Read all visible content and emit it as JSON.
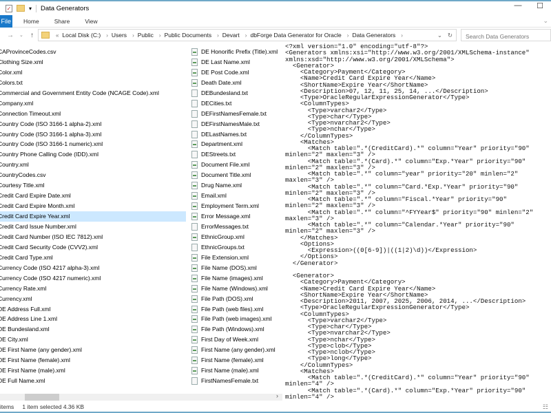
{
  "window": {
    "title": "Data Generators",
    "minimize": "—",
    "maximize": "☐"
  },
  "ribbon": {
    "file": "File",
    "tabs": [
      "Home",
      "Share",
      "View"
    ]
  },
  "address": {
    "prefix": "«",
    "crumbs": [
      "Local Disk (C:)",
      "Users",
      "Public",
      "Public Documents",
      "Devart",
      "dbForge Data Generator for Oracle",
      "Data Generators"
    ]
  },
  "search": {
    "placeholder": "Search Data Generators"
  },
  "files": {
    "column1": [
      "CAProvinceCodes.csv",
      "Clothing Size.xml",
      "Color.xml",
      "Colors.txt",
      "Commercial and Government Entity Code (NCAGE Code).xml",
      "Company.xml",
      "Connection Timeout.xml",
      "Country Code (ISO 3166-1 alpha-2).xml",
      "Country Code (ISO 3166-1 alpha-3).xml",
      "Country Code (ISO 3166-1 numeric).xml",
      "Country Phone Calling Code (IDD).xml",
      "Country.xml",
      "CountryCodes.csv",
      "Courtesy Title.xml",
      "Credit Card Expire Date.xml",
      "Credit Card Expire Month.xml",
      "Credit Card Expire Year.xml",
      "Credit Card Issue Number.xml",
      "Credit Card Number (ISO IEC 7812).xml",
      "Credit Card Security Code (CVV2).xml",
      "Credit Card Type.xml",
      "Currency Code (ISO 4217 alpha-3).xml",
      "Currency Code (ISO 4217 numeric).xml",
      "Currency Rate.xml",
      "Currency.xml",
      "DE Address Full.xml",
      "DE Address Line 1.xml",
      "DE Bundesland.xml",
      "DE City.xml",
      "DE First Name (any gender).xml",
      "DE First Name (female).xml",
      "DE First Name (male).xml",
      "DE Full Name.xml"
    ],
    "column2": [
      "DE Honorific Prefix (Title).xml",
      "DE Last Name.xml",
      "DE Post Code.xml",
      "Death Date.xml",
      "DEBundesland.txt",
      "DECities.txt",
      "DEFirstNamesFemale.txt",
      "DEFirstNamesMale.txt",
      "DELastNames.txt",
      "Department.xml",
      "DEStreets.txt",
      "Document File.xml",
      "Document Title.xml",
      "Drug Name.xml",
      "Email.xml",
      "Employment Term.xml",
      "Error Message.xml",
      "ErrorMessages.txt",
      "EthnicGroup.xml",
      "EthnicGroups.txt",
      "File Extension.xml",
      "File Name (DOS).xml",
      "File Name (images).xml",
      "File Name (Windows).xml",
      "File Path (DOS).xml",
      "File Path (web files).xml",
      "File Path (web images).xml",
      "File Path (Windows).xml",
      "First Day of Week.xml",
      "First Name (any gender).xml",
      "First Name (female).xml",
      "First Name (male).xml",
      "FirstNamesFemale.txt"
    ],
    "selected": "Credit Card Expire Year.xml"
  },
  "status": {
    "items": "items",
    "selected": "1 item selected  4.36 KB"
  },
  "preview": {
    "text": "<?xml version=\"1.0\" encoding=\"utf-8\"?>\n<Generators xmlns:xsi=\"http://www.w3.org/2001/XMLSchema-instance\"\nxmlns:xsd=\"http://www.w3.org/2001/XMLSchema\">\n  <Generator>\n    <Category>Payment</Category>\n    <Name>Credit Card Expire Year</Name>\n    <ShortName>Expire Year</ShortName>\n    <Description>07, 12, 11, 25, 14, ...</Description>\n    <Type>OracleRegularExpressionGenerator</Type>\n    <ColumnTypes>\n      <Type>varchar2</Type>\n      <Type>char</Type>\n      <Type>nvarchar2</Type>\n      <Type>nchar</Type>\n    </ColumnTypes>\n    <Matches>\n      <Match table=\".*(CreditCard).*\" column=\"Year\" priority=\"90\"\nminlen=\"2\" maxlen=\"3\" />\n      <Match table=\".*(Card).*\" column=\"Exp.*Year\" priority=\"90\"\nminlen=\"2\" maxlen=\"3\" />\n      <Match table=\".*\" column=\"year\" priority=\"20\" minlen=\"2\"\nmaxlen=\"3\" />\n      <Match table=\".*\" column=\"Card.*Exp.*Year\" priority=\"90\"\nminlen=\"2\" maxlen=\"3\" />\n      <Match table=\".*\" column=\"Fiscal.*Year\" priority=\"90\"\nminlen=\"2\" maxlen=\"3\" />\n      <Match table=\".*\" column=\"^FYYear$\" priority=\"90\" minlen=\"2\"\nmaxlen=\"3\" />\n      <Match table=\".*\" column=\"Calendar.*Year\" priority=\"90\"\nminlen=\"2\" maxlen=\"3\" />\n    </Matches>\n    <Options>\n      <Expression>((0[6-9])|((1|2)\\d))</Expression>\n    </Options>\n  </Generator>\n\n  <Generator>\n    <Category>Payment</Category>\n    <Name>Credit Card Expire Year</Name>\n    <ShortName>Expire Year</ShortName>\n    <Description>2011, 2007, 2025, 2006, 2014, ...</Description>\n    <Type>OracleRegularExpressionGenerator</Type>\n    <ColumnTypes>\n      <Type>varchar2</Type>\n      <Type>char</Type>\n      <Type>nvarchar2</Type>\n      <Type>nchar</Type>\n      <Type>clob</Type>\n      <Type>nclob</Type>\n      <Type>long</Type>\n    </ColumnTypes>\n    <Matches>\n      <Match table=\".*(CreditCard).*\" column=\"Year\" priority=\"90\"\nminlen=\"4\" />\n      <Match table=\".*(Card).*\" column=\"Exp.*Year\" priority=\"90\"\nminlen=\"4\" />"
  },
  "colors": {
    "accent": "#1979ca",
    "selection": "#cce8ff",
    "border": "#6fa8c8"
  }
}
